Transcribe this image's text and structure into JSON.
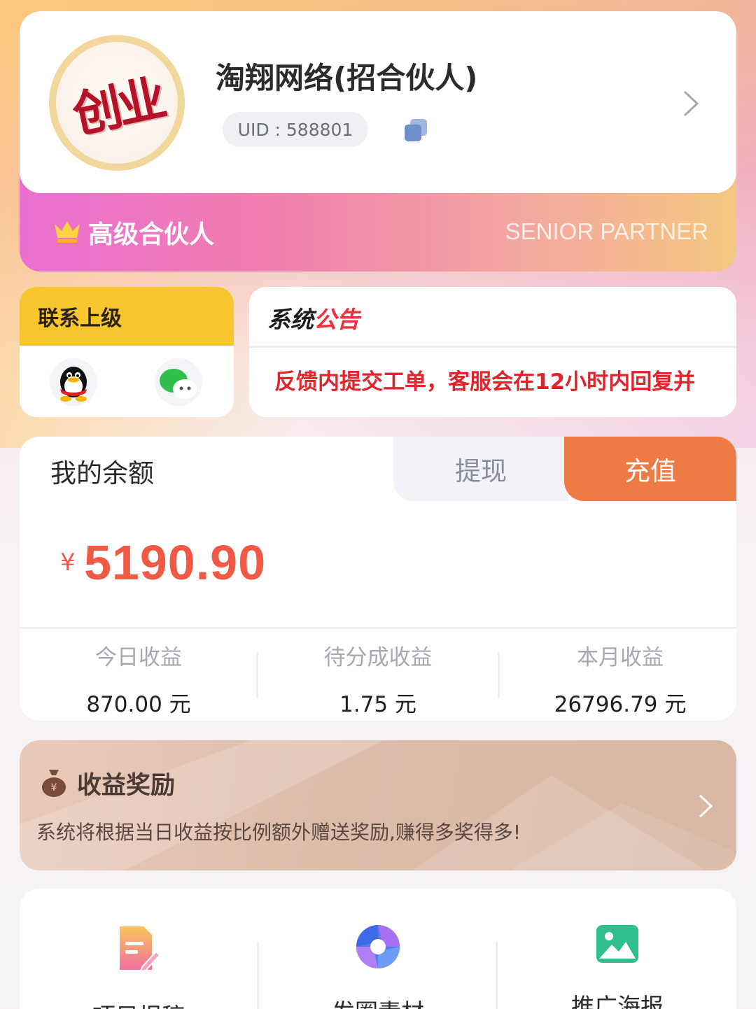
{
  "profile": {
    "avatar_text": "创业",
    "name": "淘翔网络(招合伙人)",
    "uid": "UID : 588801",
    "level_cn": "高级合伙人",
    "level_en": "SENIOR PARTNER"
  },
  "contact": {
    "title": "联系上级",
    "icons": [
      "qq-icon",
      "wechat-icon"
    ]
  },
  "notice": {
    "title_black": "系统",
    "title_red": "公告",
    "text": "反馈内提交工单，客服会在12小时内回复并"
  },
  "balance": {
    "label": "我的余额",
    "withdraw_label": "提现",
    "recharge_label": "充值",
    "currency": "¥",
    "amount": "5190.90",
    "stats": [
      {
        "label": "今日收益",
        "value": "870.00 元"
      },
      {
        "label": "待分成收益",
        "value": "1.75 元"
      },
      {
        "label": "本月收益",
        "value": "26796.79 元"
      }
    ]
  },
  "reward": {
    "title": "收益奖励",
    "desc": "系统将根据当日收益按比例额外赠送奖励,赚得多奖得多!"
  },
  "tools": [
    {
      "label": "项目报稿",
      "icon": "document-edit-icon"
    },
    {
      "label": "发圈素材",
      "icon": "aperture-icon"
    },
    {
      "label": "推广海报",
      "icon": "image-icon"
    }
  ],
  "colors": {
    "accent_orange": "#ee7b45",
    "amount_red": "#f05a45",
    "notice_red": "#e3232c",
    "contact_yellow": "#f7c52d"
  }
}
